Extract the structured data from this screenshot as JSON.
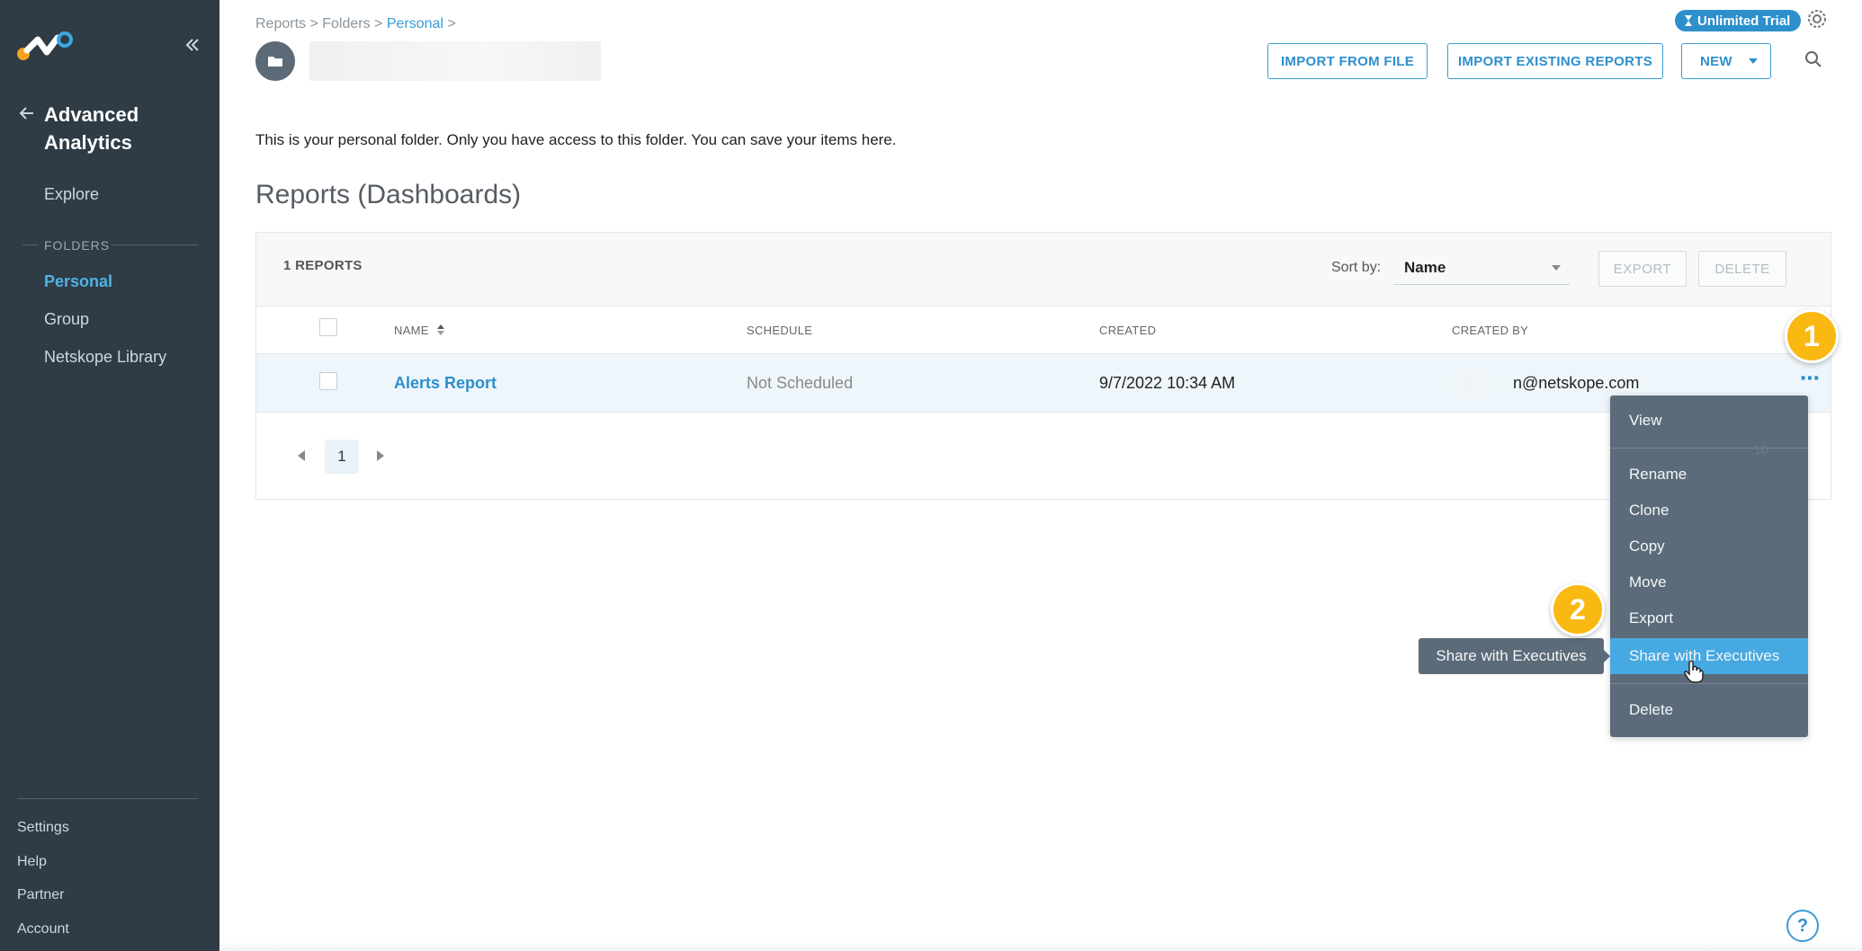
{
  "sidebar": {
    "app_title": "Advanced Analytics",
    "nav_explore": "Explore",
    "folders_label": "FOLDERS",
    "folders": [
      "Personal",
      "Group",
      "Netskope Library"
    ],
    "active_folder": "Personal",
    "bottom_items": [
      "Settings",
      "Help",
      "Partner",
      "Account"
    ]
  },
  "breadcrumb": {
    "part1": "Reports > Folders > ",
    "current": "Personal",
    "suffix": " >"
  },
  "header": {
    "trial_label": "Unlimited Trial",
    "import_file_label": "IMPORT FROM FILE",
    "import_existing_label": "IMPORT EXISTING REPORTS",
    "new_label": "NEW"
  },
  "intro_text": "This is your personal folder. Only you have access to this folder. You can save your items here.",
  "section_title": "Reports (Dashboards)",
  "table": {
    "count_label": "1 REPORTS",
    "sort_label": "Sort by:",
    "sort_value": "Name",
    "export_label": "EXPORT",
    "delete_label": "DELETE",
    "columns": [
      "NAME",
      "SCHEDULE",
      "CREATED",
      "CREATED BY"
    ],
    "rows": [
      {
        "name": "Alerts Report",
        "schedule": "Not Scheduled",
        "created": "9/7/2022 10:34 AM",
        "created_by": "n@netskope.com"
      }
    ],
    "current_page": "1"
  },
  "menu": {
    "items": [
      "View",
      "Rename",
      "Clone",
      "Copy",
      "Move",
      "Export",
      "Share with Executives",
      "Delete"
    ],
    "highlighted": "Share with Executives",
    "ghost_text": "10"
  },
  "tooltip": "Share with Executives",
  "steps": [
    "1",
    "2"
  ],
  "colors": {
    "sidebar_bg": "#2f3b45",
    "accent": "#2d8fcc",
    "menu_bg": "#5b6b79",
    "menu_highlight": "#46a9e1",
    "step_badge": "#f9b912"
  },
  "icons": [
    "logo-icon",
    "collapse-icon",
    "back-arrow-icon",
    "folder-icon",
    "hourglass-icon",
    "gear-icon",
    "search-icon",
    "sort-icon",
    "chevron-left-icon",
    "chevron-right-icon",
    "more-icon",
    "hand-cursor-icon",
    "help-icon"
  ]
}
